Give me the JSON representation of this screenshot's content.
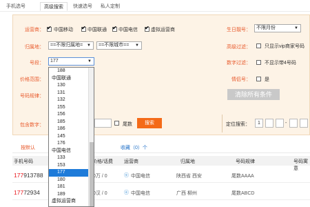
{
  "tabs": [
    {
      "label": "手机选号",
      "active": false
    },
    {
      "label": "高级搜索",
      "active": true
    },
    {
      "label": "快速选号",
      "active": false
    },
    {
      "label": "私人定制",
      "active": false
    }
  ],
  "filters": {
    "carrier_label": "运营商：",
    "carriers": [
      "中国移动",
      "中国联通",
      "中国电信",
      "虚拟运营商"
    ],
    "region_label": "归属地：",
    "province_select": "==不限归属地=",
    "city_select": "==不限城市==",
    "segment_label": "号段：",
    "segment_value": "177",
    "price_label": "价格范围：",
    "rule_label": "号码规律：",
    "contains_label": "包含数字：",
    "tail_label": "尾数",
    "search_button": "搜索",
    "birthday_label": "生日靓号：",
    "birthday_select": "不限月份",
    "advanced_label": "高级过滤：",
    "advanced_option": "只显示vip商家号码",
    "digit_label": "数字过滤：",
    "digit_option": "不显示带4号码",
    "lover_label": "情侣号：",
    "lover_option": "是",
    "clear_button": "清除所有条件",
    "position_label": "定位搜索：",
    "position_first": "1",
    "position_dash": "-"
  },
  "dropdown": {
    "items": [
      {
        "label": "188",
        "group": false,
        "selected": false
      },
      {
        "label": "中国联通",
        "group": true,
        "selected": false
      },
      {
        "label": "130",
        "group": false,
        "selected": false
      },
      {
        "label": "131",
        "group": false,
        "selected": false
      },
      {
        "label": "132",
        "group": false,
        "selected": false
      },
      {
        "label": "155",
        "group": false,
        "selected": false
      },
      {
        "label": "156",
        "group": false,
        "selected": false
      },
      {
        "label": "185",
        "group": false,
        "selected": false
      },
      {
        "label": "186",
        "group": false,
        "selected": false
      },
      {
        "label": "145",
        "group": false,
        "selected": false
      },
      {
        "label": "176",
        "group": false,
        "selected": false
      },
      {
        "label": "中国电信",
        "group": true,
        "selected": false
      },
      {
        "label": "133",
        "group": false,
        "selected": false
      },
      {
        "label": "153",
        "group": false,
        "selected": false
      },
      {
        "label": "177",
        "group": false,
        "selected": true
      },
      {
        "label": "180",
        "group": false,
        "selected": false
      },
      {
        "label": "181",
        "group": false,
        "selected": false
      },
      {
        "label": "189",
        "group": false,
        "selected": false
      },
      {
        "label": "虚拟运营商",
        "group": true,
        "selected": false
      },
      {
        "label": "170",
        "group": false,
        "selected": false
      }
    ]
  },
  "list": {
    "sort_tab": "按默认",
    "favorites": "收藏（0）个",
    "columns": [
      "手机号码",
      "价格/话费",
      "运营商",
      "归属地",
      "号码规律",
      "号码寓意"
    ],
    "rows": [
      {
        "number_red": "177",
        "number_rest": "913788",
        "price": "0万 / 0",
        "carrier": "中国电信",
        "region": "陕西省 西安",
        "rule": "尾数AAAA"
      },
      {
        "number_red": "177",
        "number_rest": "72934",
        "price": "0汉 / 0",
        "carrier": "中国电信",
        "region": "广西 柳州",
        "rule": "尾数ABCD"
      }
    ]
  },
  "colors": {
    "accent": "#f46a18",
    "label": "#e85a2c",
    "number": "#e8141a",
    "selected": "#1e7bd9"
  }
}
